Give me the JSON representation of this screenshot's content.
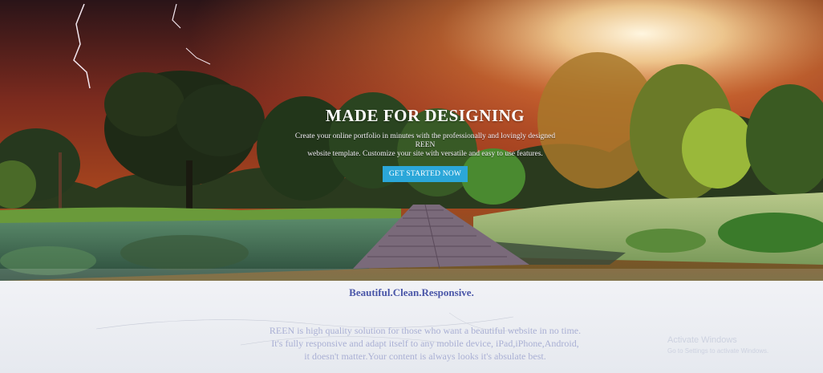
{
  "hero": {
    "title": "MADE FOR DESIGNING",
    "description_line1": "Create your online portfolio in minutes with the professionally and lovingly designed REEN",
    "description_line2": "website template. Customize your site with versatile and easy to use features.",
    "cta_label": "GET STARTED NOW",
    "cta_color": "#2ba7d9"
  },
  "features": {
    "tagline": "Beautiful.Clean.Responsive.",
    "line1": "REEN is high quality solution for those who want a beautiful website in no time.",
    "line2": "It's fully responsive and adapt itself to any mobile device, iPad,iPhone,Android,",
    "line3": "it doesn't matter.Your content is always looks it's absulate best.",
    "tagline_color": "#4a56a8"
  },
  "watermark": {
    "title": "Activate Windows",
    "subtitle": "Go to Settings to activate Windows."
  }
}
